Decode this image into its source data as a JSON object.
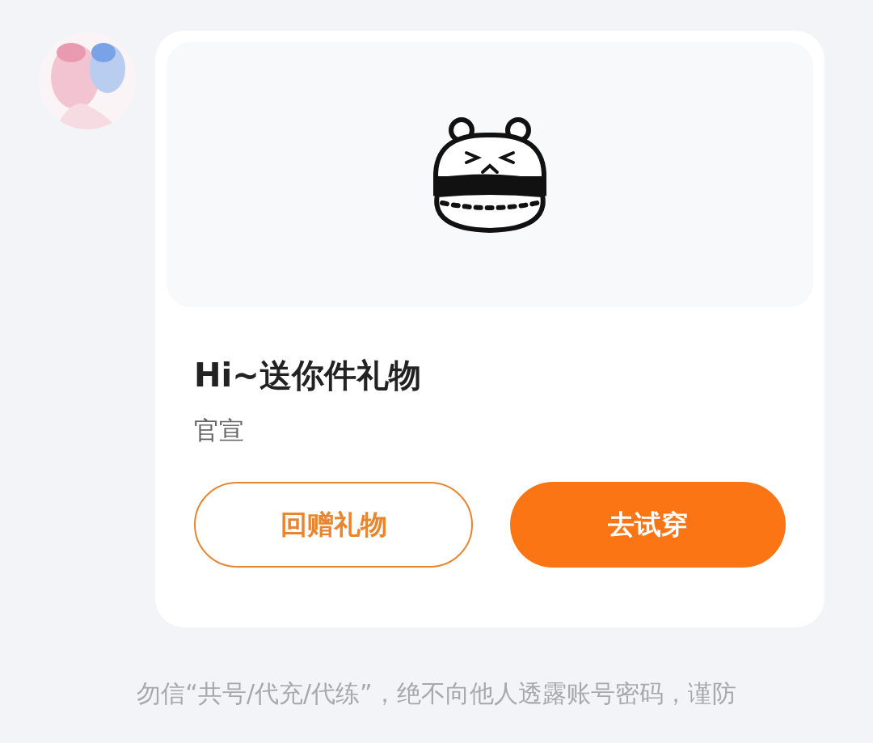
{
  "message": {
    "card": {
      "title": "Hi~送你件礼物",
      "subtitle": "官宣",
      "buttons": [
        {
          "label": "回赠礼物",
          "kind": "outline"
        },
        {
          "label": "去试穿",
          "kind": "filled"
        }
      ]
    }
  },
  "notice": "勿信“共号/代充/代练”，绝不向他人透露账号密码，谨防"
}
